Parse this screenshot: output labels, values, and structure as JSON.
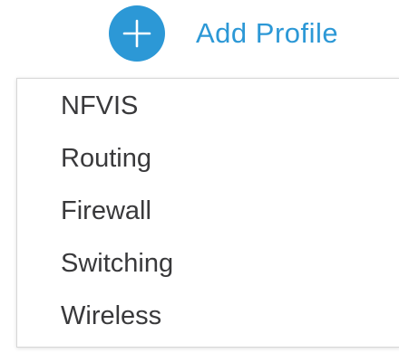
{
  "add_profile": {
    "label": "Add Profile",
    "icon": "plus-circle-icon",
    "accent_color": "#2c98d6",
    "icon_fg_color": "#ffffff"
  },
  "menu": {
    "items": [
      {
        "label": "NFVIS"
      },
      {
        "label": "Routing"
      },
      {
        "label": "Firewall"
      },
      {
        "label": "Switching"
      },
      {
        "label": "Wireless"
      }
    ],
    "text_color": "#39393b"
  }
}
